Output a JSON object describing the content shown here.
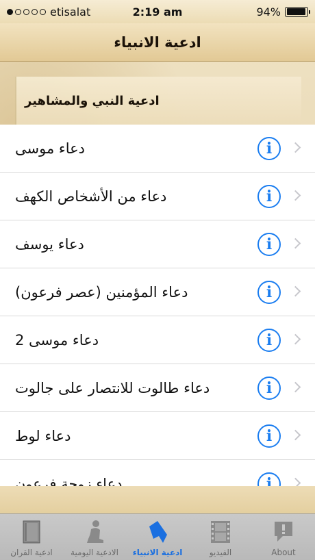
{
  "status": {
    "carrier": "etisalat",
    "time": "2:19 am",
    "battery": "94%",
    "battery_level": 0.94,
    "signal_bars_filled": 1,
    "signal_bars_total": 5
  },
  "nav": {
    "title": "ادعية الانبياء"
  },
  "section": {
    "title": "ادعية النبي والمشاهير"
  },
  "list": {
    "items": [
      {
        "label": "دعاء موسى"
      },
      {
        "label": "دعاء من الأشخاص الكهف"
      },
      {
        "label": "دعاء يوسف"
      },
      {
        "label": "دعاء المؤمنين (عصر فرعون)"
      },
      {
        "label": "دعاء موسى 2"
      },
      {
        "label": "دعاء طالوت للانتصار على جالوت"
      },
      {
        "label": "دعاء لوط"
      },
      {
        "label": "دعاء زوجة فرعون"
      }
    ],
    "info_glyph": "i"
  },
  "tabs": [
    {
      "label": "ادعية القران",
      "icon": "book-icon"
    },
    {
      "label": "الادعية اليومية",
      "icon": "praying-person-icon"
    },
    {
      "label": "ادعية الانبياء",
      "icon": "bookmark-icon",
      "active": true
    },
    {
      "label": "الفيديو",
      "icon": "film-icon"
    },
    {
      "label": "About",
      "icon": "speech-bubble-icon"
    }
  ],
  "colors": {
    "accent": "#1a7df0",
    "active_tab": "#1a6fe0",
    "inactive_tab": "#6a6a6a"
  }
}
